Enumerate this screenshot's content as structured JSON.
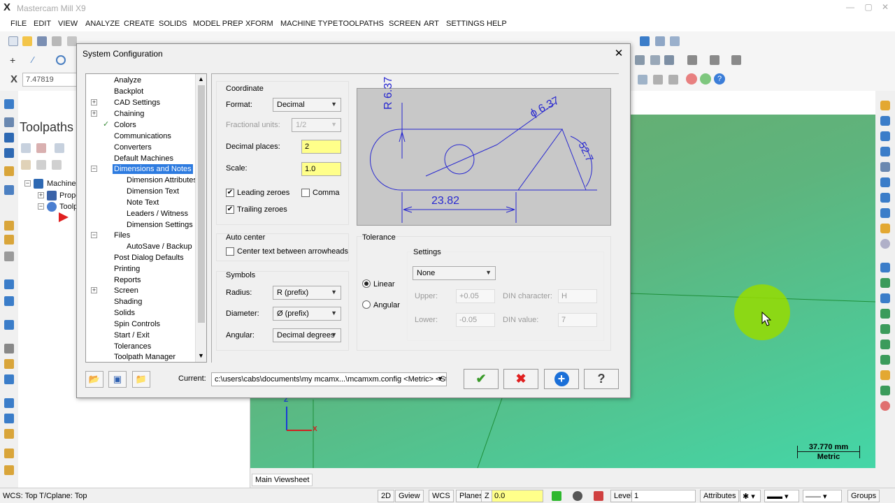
{
  "app": {
    "title": "Mastercam Mill X9",
    "icon": "mastercam-logo-icon"
  },
  "menu": [
    "FILE",
    "EDIT",
    "VIEW",
    "ANALYZE",
    "CREATE",
    "SOLIDS",
    "MODEL PREP",
    "XFORM",
    "MACHINE TYPE",
    "TOOLPATHS",
    "SCREEN",
    "ART",
    "SETTINGS",
    "HELP"
  ],
  "coord_bar": {
    "axis": "X",
    "value": "7.47819"
  },
  "left_panel": {
    "title": "Toolpaths",
    "tree": [
      "Machine G",
      "Prope",
      "Toolp"
    ]
  },
  "dialog": {
    "title": "System Configuration",
    "categories": [
      {
        "label": "Analyze"
      },
      {
        "label": "Backplot"
      },
      {
        "label": "CAD Settings",
        "expander": "+"
      },
      {
        "label": "Chaining"
      },
      {
        "label": "Colors",
        "expander": "+",
        "checked": true
      },
      {
        "label": "Communications"
      },
      {
        "label": "Converters"
      },
      {
        "label": "Default Machines"
      },
      {
        "label": "Dimensions and Notes",
        "expander": "-",
        "selected": true
      },
      {
        "label": "Dimension Attributes",
        "child": true
      },
      {
        "label": "Dimension Text",
        "child": true
      },
      {
        "label": "Note Text",
        "child": true
      },
      {
        "label": "Leaders / Witness",
        "child": true
      },
      {
        "label": "Dimension Settings",
        "child": true
      },
      {
        "label": "Files",
        "expander": "-"
      },
      {
        "label": "AutoSave / Backup",
        "child": true
      },
      {
        "label": "Post Dialog Defaults"
      },
      {
        "label": "Printing"
      },
      {
        "label": "Reports"
      },
      {
        "label": "Screen",
        "expander": "+"
      },
      {
        "label": "Shading"
      },
      {
        "label": "Solids"
      },
      {
        "label": "Spin Controls"
      },
      {
        "label": "Start / Exit"
      },
      {
        "label": "Tolerances"
      },
      {
        "label": "Toolpath Manager"
      }
    ],
    "coordinate": {
      "heading": "Coordinate",
      "format_label": "Format:",
      "format_value": "Decimal",
      "fractional_label": "Fractional units:",
      "fractional_value": "1/2",
      "decimal_places_label": "Decimal places:",
      "decimal_places_value": "2",
      "scale_label": "Scale:",
      "scale_value": "1.0",
      "leading_zeroes": "Leading zeroes",
      "leading_checked": true,
      "comma": "Comma",
      "comma_checked": false,
      "trailing_zeroes": "Trailing zeroes",
      "trailing_checked": true
    },
    "auto_center": {
      "heading": "Auto center",
      "option": "Center text between arrowheads",
      "checked": false
    },
    "symbols": {
      "heading": "Symbols",
      "radius_label": "Radius:",
      "radius_value": "R (prefix)",
      "diameter_label": "Diameter:",
      "diameter_value": "Ø (prefix)",
      "angular_label": "Angular:",
      "angular_value": "Decimal degrees"
    },
    "preview": {
      "radius_text": "R 6.37",
      "diameter_text": "ϕ 6.37",
      "angle_text": "52.7",
      "linear_text": "23.82"
    },
    "tolerance": {
      "heading": "Tolerance",
      "linear": "Linear",
      "angular": "Angular",
      "selected": "Linear",
      "settings_heading": "Settings",
      "settings_value": "None",
      "upper_label": "Upper:",
      "upper_value": "+0.05",
      "lower_label": "Lower:",
      "lower_value": "-0.05",
      "din_char_label": "DIN character:",
      "din_char_value": "H",
      "din_value_label": "DIN value:",
      "din_value_value": "7"
    },
    "current_label": "Current:",
    "current_value": "c:\\users\\cabs\\documents\\my mcamx...\\mcamxm.config <Metric> <Star",
    "buttons": {
      "ok": "✔",
      "cancel": "✖",
      "add": "+",
      "help": "?"
    }
  },
  "viewport": {
    "scale_value": "37.770 mm",
    "scale_unit": "Metric",
    "axis_z": "Z",
    "axis_x": "X",
    "tab": "Main Viewsheet"
  },
  "status": {
    "text": "WCS: Top  T/Cplane: Top",
    "buttons": [
      "2D",
      "Gview",
      "WCS",
      "Planes"
    ],
    "z_label": "Z",
    "z_value": "0.0",
    "level_label": "Level",
    "level_value": "1",
    "attributes": "Attributes",
    "groups": "Groups"
  },
  "colors": {
    "accent": "#2d7be0",
    "highlight_field": "#ffff8a",
    "ok_green": "#3a9a2a",
    "cancel_red": "#e02020",
    "add_blue": "#1a6fd8"
  }
}
